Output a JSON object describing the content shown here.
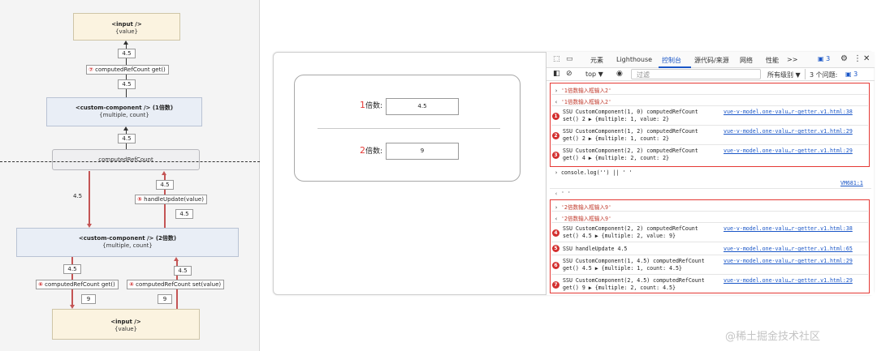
{
  "diagram": {
    "input_top": {
      "title": "<input />",
      "sub": "{value}"
    },
    "val_top": "4.5",
    "lbl_7": {
      "num": "⑦",
      "text": "computedRefCount get()"
    },
    "val_mid1": "4.5",
    "comp1": {
      "title": "<custom-component />  (1倍数)",
      "sub": "{multiple, count}"
    },
    "val_mid2": "4.5",
    "computed": "computedRefCount",
    "val_left": "4.5",
    "val_r1": "4.5",
    "lbl_5": {
      "num": "⑤",
      "text": "handleUpdate(value)"
    },
    "val_r2": "4.5",
    "comp2": {
      "title": "<custom-component />  (2倍数)",
      "sub": "{multiple, count}"
    },
    "val_b1": "4.5",
    "val_b2": "4.5",
    "lbl_6": {
      "num": "⑥",
      "text": "computedRefCount get()"
    },
    "lbl_4": {
      "num": "④",
      "text": "computedRefCount set(value)"
    },
    "val_b3": "9",
    "val_b4": "9",
    "input_bottom": {
      "title": "<input />",
      "sub": "{value}"
    }
  },
  "app": {
    "field1": {
      "num": "1",
      "label": "倍数:",
      "value": "4.5"
    },
    "field2": {
      "num": "2",
      "label": "倍数:",
      "value": "9"
    }
  },
  "devtools": {
    "tabs": [
      "元素",
      "Lighthouse",
      "控制台",
      "源代码/来源",
      "网络",
      "性能",
      ">>"
    ],
    "active_tab": "控制台",
    "msg_count": "3",
    "toolbar": {
      "context": "top ▼",
      "filter_placeholder": "过滤",
      "levels": "所有级别 ▼",
      "issues": "3 个问题:",
      "issues_count": "3"
    },
    "log": {
      "l1": "'1倍数输入框输入2'",
      "l2": "'1倍数输入框输入2'",
      "e1a": "SSU CustomComponent(1, 0) computedRefCount",
      "e1b": "set() 2 ▶ {multiple: 1, value: 2}",
      "e1link": "vue-v-model.one-valu…r-getter.v1.html:38",
      "e2a": "SSU CustomComponent(1, 2) computedRefCount",
      "e2b": "get() 2 ▶ {multiple: 1, count: 2}",
      "e2link": "vue-v-model.one-valu…r-getter.v1.html:29",
      "e3a": "SSU CustomComponent(2, 2) computedRefCount",
      "e3b": "get() 4 ▶ {multiple: 2, count: 2}",
      "e3link": "vue-v-model.one-valu…r-getter.v1.html:29",
      "cmd": "console.log('') || ' '",
      "vm": "VM681:1",
      "ret": "' '",
      "l3": "'2倍数输入框输入9'",
      "l4": "'2倍数输入框输入9'",
      "e4a": "SSU CustomComponent(2, 2) computedRefCount",
      "e4b": "set() 4.5 ▶ {multiple: 2, value: 9}",
      "e4link": "vue-v-model.one-valu…r-getter.v1.html:38",
      "e5a": "SSU handleUpdate 4.5",
      "e5link": "vue-v-model.one-valu…r-getter.v1.html:65",
      "e6a": "SSU CustomComponent(1, 4.5) computedRefCount",
      "e6b": "get() 4.5 ▶ {multiple: 1, count: 4.5}",
      "e6link": "vue-v-model.one-valu…r-getter.v1.html:29",
      "e7a": "SSU CustomComponent(2, 4.5) computedRefCount",
      "e7b": "get() 9 ▶ {multiple: 2, count: 4.5}",
      "e7link": "vue-v-model.one-valu…r-getter.v1.html:29"
    },
    "badges": [
      "1",
      "2",
      "3",
      "4",
      "5",
      "6",
      "7"
    ]
  },
  "watermark": "@稀土掘金技术社区",
  "colors": {
    "accent_red": "#e53935",
    "link_blue": "#1a56c7",
    "node_yellow": "#fbf3e0",
    "node_blue": "#e9eef6"
  }
}
